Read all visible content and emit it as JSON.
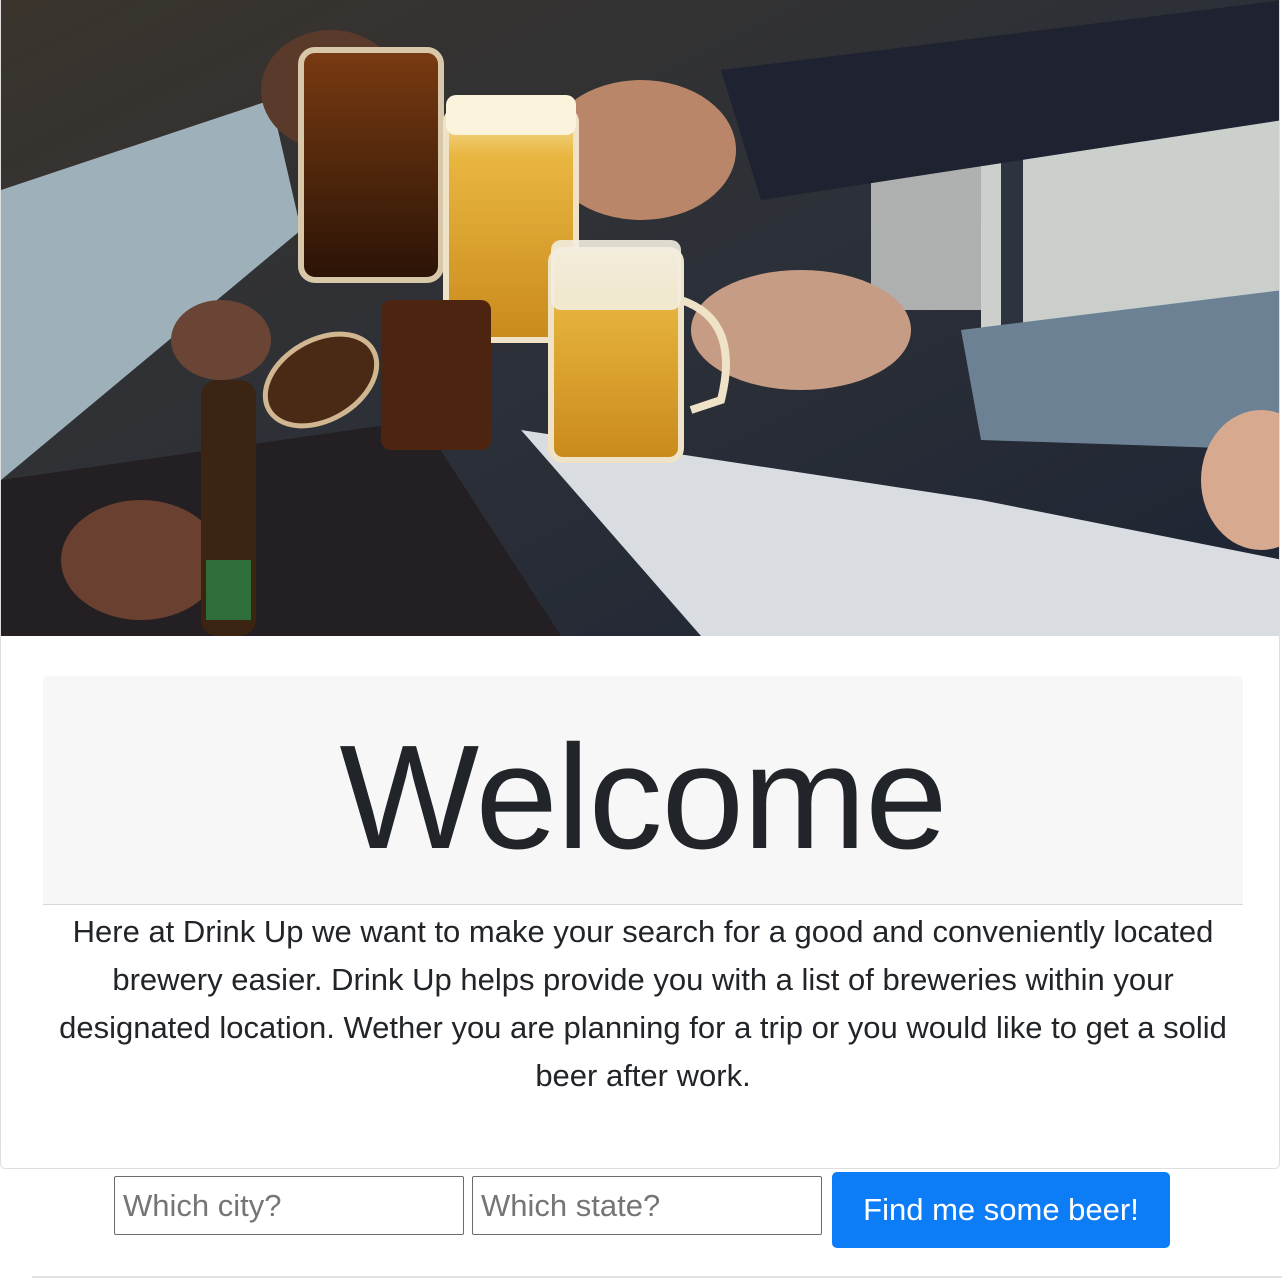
{
  "hero": {
    "image_subject": "friends toasting beer mugs and bottles"
  },
  "jumbotron": {
    "heading": "Welcome"
  },
  "intro": {
    "text": "Here at Drink Up we want to make your search for a good and conveniently located brewery easier. Drink Up helps provide you with a list of breweries within your designated location. Wether you are planning for a trip or you would like to get a solid beer after work."
  },
  "search": {
    "city_placeholder": "Which city?",
    "state_placeholder": "Which state?",
    "city_value": "",
    "state_value": "",
    "button_label": "Find me some beer!"
  },
  "colors": {
    "button": "#0d7cf7",
    "jumbotron_bg": "#f7f7f7",
    "text": "#212529"
  }
}
